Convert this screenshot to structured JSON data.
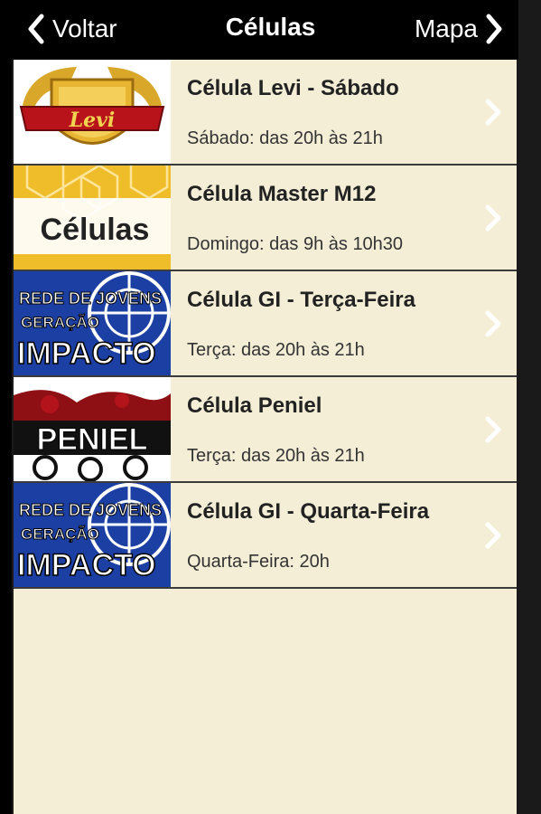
{
  "nav": {
    "back_label": "Voltar",
    "title": "Células",
    "map_label": "Mapa"
  },
  "items": [
    {
      "title": "Célula Levi - Sábado",
      "subtitle": "Sábado: das 20h às 21h",
      "image_text": "Levi"
    },
    {
      "title": "Célula Master M12",
      "subtitle": "Domingo: das 9h às 10h30",
      "image_text": "Células"
    },
    {
      "title": "Célula GI - Terça-Feira",
      "subtitle": "Terça: das 20h às 21h",
      "image_text": [
        "REDE DE JOVENS",
        "GERAÇÃO",
        "IMPACTO"
      ]
    },
    {
      "title": "Célula Peniel",
      "subtitle": "Terça: das 20h às 21h",
      "image_text": "PENIEL"
    },
    {
      "title": "Célula GI - Quarta-Feira",
      "subtitle": "Quarta-Feira: 20h",
      "image_text": [
        "REDE DE JOVENS",
        "GERAÇÃO",
        "IMPACTO"
      ]
    }
  ],
  "icons": {
    "back": "chevron-left-icon",
    "map": "chevron-right-icon",
    "row": "chevron-right-icon"
  },
  "colors": {
    "nav_bg": "#000000",
    "list_bg": "#f4eed6",
    "separator": "#3b3b3b",
    "title_text": "#222222",
    "chevron": "#ffffff"
  }
}
